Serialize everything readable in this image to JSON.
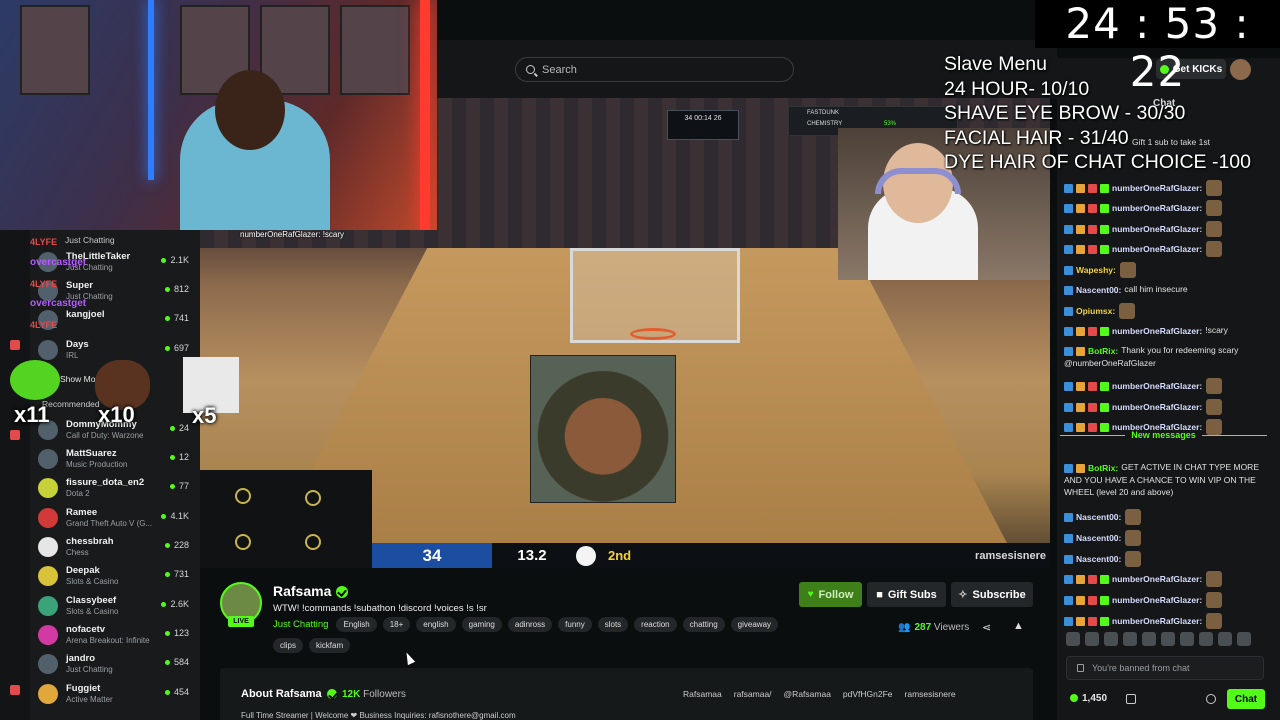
{
  "timer": "24 : 53 : 22",
  "search": {
    "placeholder": "Search"
  },
  "slave_menu": {
    "lines": [
      "Slave Menu",
      "24 HOUR- 10/10",
      "SHAVE EYE BROW - 30/30",
      "FACIAL HAIR - 31/40",
      "DYE HAIR OF CHAT CHOICE -100"
    ]
  },
  "header": {
    "get_kicks": "Get KICKs"
  },
  "sidebar": {
    "items": [
      {
        "name": "Just Chatting",
        "category": "",
        "viewers": ""
      },
      {
        "name": "TheLittleTaker",
        "category": "Just Chatting",
        "viewers": "2.1K"
      },
      {
        "name": "Super",
        "category": "Just Chatting",
        "viewers": "812"
      },
      {
        "name": "kangjoel",
        "category": "",
        "viewers": "741"
      },
      {
        "name": "Days",
        "category": "IRL",
        "viewers": "697"
      }
    ],
    "show_more": "Show More",
    "recommended_label": "Recommended",
    "recommended": [
      {
        "name": "DommyMommy",
        "category": "Call of Duty: Warzone",
        "viewers": "24"
      },
      {
        "name": "MattSuarez",
        "category": "Music Production",
        "viewers": "12"
      },
      {
        "name": "fissure_dota_en2",
        "category": "Dota 2",
        "viewers": "77"
      },
      {
        "name": "Ramee",
        "category": "Grand Theft Auto V (G...",
        "viewers": "4.1K"
      },
      {
        "name": "chessbrah",
        "category": "Chess",
        "viewers": "228"
      },
      {
        "name": "Deepak",
        "category": "Slots & Casino",
        "viewers": "731"
      },
      {
        "name": "Classybeef",
        "category": "Slots & Casino",
        "viewers": "2.6K"
      },
      {
        "name": "nofacetv",
        "category": "Arena Breakout: Infinite",
        "viewers": "123"
      },
      {
        "name": "jandro",
        "category": "Just Chatting",
        "viewers": "584"
      },
      {
        "name": "Fuggiet",
        "category": "Active Matter",
        "viewers": "454"
      }
    ],
    "alerts": [
      "4LYFE",
      "overcastget",
      "4LYFE",
      "overcastget",
      "4LYFE"
    ]
  },
  "overlays": {
    "chat_overlay_line": "numberOneRafGlazer: !scary",
    "mults": [
      "x11",
      "x10",
      "x5"
    ]
  },
  "game": {
    "score_top": "34  00:14  26",
    "team_score": "34",
    "clock": "13.2",
    "period": "2nd",
    "credit": "ramsesisnere",
    "scorebug_left": "FASTDUNK",
    "scorebug_sub": "CHEMISTRY",
    "scorebug_pct": "53%"
  },
  "chat": {
    "title": "Chat",
    "sub_note": "Gift 1 sub to take 1st",
    "messages": [
      {
        "user": "numberOneRafGlazer:",
        "text": ""
      },
      {
        "user": "numberOneRafGlazer:",
        "text": ""
      },
      {
        "user": "numberOneRafGlazer:",
        "text": ""
      },
      {
        "user": "numberOneRafGlazer:",
        "text": ""
      },
      {
        "user": "Wapeshy:",
        "text": ""
      },
      {
        "user": "Nascent00:",
        "text": "call him insecure"
      },
      {
        "user": "Opiumsx:",
        "text": ""
      },
      {
        "user": "numberOneRafGlazer:",
        "text": "!scary"
      },
      {
        "user": "BotRix:",
        "text": "Thank you for redeeming scary @numberOneRafGlazer"
      },
      {
        "user": "numberOneRafGlazer:",
        "text": ""
      },
      {
        "user": "numberOneRafGlazer:",
        "text": ""
      },
      {
        "user": "numberOneRafGlazer:",
        "text": ""
      }
    ],
    "new_messages": "New messages",
    "messages_after": [
      {
        "user": "BotRix:",
        "text": "GET ACTIVE IN CHAT TYPE MORE AND YOU HAVE A CHANCE TO WIN VIP ON THE WHEEL (level 20 and above)"
      },
      {
        "user": "Nascent00:",
        "text": ""
      },
      {
        "user": "Nascent00:",
        "text": ""
      },
      {
        "user": "Nascent00:",
        "text": ""
      },
      {
        "user": "numberOneRafGlazer:",
        "text": ""
      },
      {
        "user": "numberOneRafGlazer:",
        "text": ""
      },
      {
        "user": "numberOneRafGlazer:",
        "text": ""
      }
    ],
    "banned": "You're banned from chat",
    "kicks": "1,450",
    "chat_button": "Chat"
  },
  "channel": {
    "name": "Rafsama",
    "live": "LIVE",
    "title": "WTW! !commands !subathon !discord !voices !s !sr",
    "category": "Just Chatting",
    "tags": [
      "English",
      "18+",
      "english",
      "gaming",
      "adinross",
      "funny",
      "slots",
      "reaction",
      "chatting",
      "giveaway",
      "clips",
      "kickfam"
    ],
    "follow": "Follow",
    "gift_subs": "Gift Subs",
    "subscribe": "Subscribe",
    "viewers_count": "287",
    "viewers_label": "Viewers",
    "about_title": "About Rafsama",
    "followers_count": "12K",
    "followers_label": "Followers",
    "socials": [
      "Rafsamaa",
      "rafsamaa/",
      "@Rafsamaa",
      "pdVfHGn2Fe",
      "ramsesisnere"
    ],
    "description": "Full Time Streamer | Welcome ❤ Business Inquiries: rafisnothere@gmail.com"
  }
}
